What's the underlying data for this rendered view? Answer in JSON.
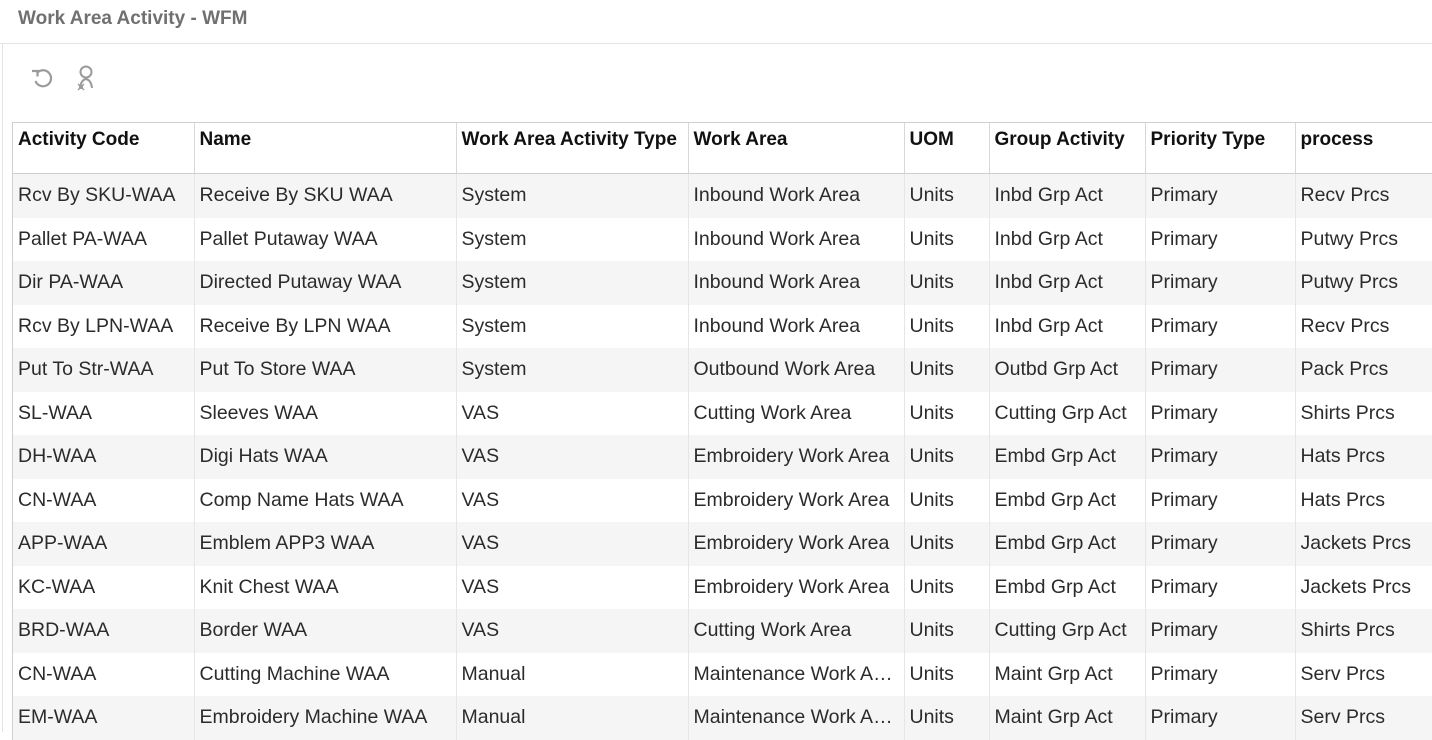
{
  "header": {
    "title": "Work Area Activity - WFM"
  },
  "toolbar": {
    "buttons": [
      {
        "icon": "refresh-icon"
      },
      {
        "icon": "user-search-icon"
      }
    ]
  },
  "table": {
    "columns": [
      "Activity Code",
      "Name",
      "Work Area Activity Type",
      "Work Area",
      "UOM",
      "Group Activity",
      "Priority Type",
      "process"
    ],
    "rows": [
      [
        "Rcv By SKU-WAA",
        "Receive By SKU WAA",
        "System",
        "Inbound Work Area",
        "Units",
        "Inbd Grp Act",
        "Primary",
        "Recv Prcs"
      ],
      [
        "Pallet PA-WAA",
        "Pallet Putaway WAA",
        "System",
        "Inbound Work Area",
        "Units",
        "Inbd Grp Act",
        "Primary",
        "Putwy Prcs"
      ],
      [
        "Dir PA-WAA",
        "Directed Putaway WAA",
        "System",
        "Inbound Work Area",
        "Units",
        "Inbd Grp Act",
        "Primary",
        "Putwy Prcs"
      ],
      [
        "Rcv By LPN-WAA",
        "Receive By LPN WAA",
        "System",
        "Inbound Work Area",
        "Units",
        "Inbd Grp Act",
        "Primary",
        "Recv Prcs"
      ],
      [
        "Put To Str-WAA",
        "Put To Store WAA",
        "System",
        "Outbound Work Area",
        "Units",
        "Outbd Grp Act",
        "Primary",
        "Pack Prcs"
      ],
      [
        "SL-WAA",
        "Sleeves WAA",
        "VAS",
        "Cutting Work Area",
        "Units",
        "Cutting Grp Act",
        "Primary",
        "Shirts Prcs"
      ],
      [
        "DH-WAA",
        "Digi Hats WAA",
        "VAS",
        "Embroidery Work Area",
        "Units",
        "Embd Grp Act",
        "Primary",
        "Hats Prcs"
      ],
      [
        "CN-WAA",
        "Comp Name Hats WAA",
        "VAS",
        "Embroidery Work Area",
        "Units",
        "Embd Grp Act",
        "Primary",
        "Hats Prcs"
      ],
      [
        "APP-WAA",
        "Emblem APP3 WAA",
        "VAS",
        "Embroidery Work Area",
        "Units",
        "Embd Grp Act",
        "Primary",
        "Jackets Prcs"
      ],
      [
        "KC-WAA",
        "Knit Chest WAA",
        "VAS",
        "Embroidery Work Area",
        "Units",
        "Embd Grp Act",
        "Primary",
        "Jackets Prcs"
      ],
      [
        "BRD-WAA",
        "Border WAA",
        "VAS",
        "Cutting Work Area",
        "Units",
        "Cutting Grp Act",
        "Primary",
        "Shirts Prcs"
      ],
      [
        "CN-WAA",
        "Cutting Machine WAA",
        "Manual",
        "Maintenance Work Area",
        "Units",
        "Maint Grp Act",
        "Primary",
        "Serv Prcs"
      ],
      [
        "EM-WAA",
        "Embroidery Machine WAA",
        "Manual",
        "Maintenance Work Area",
        "Units",
        "Maint Grp Act",
        "Primary",
        "Serv Prcs"
      ]
    ]
  }
}
